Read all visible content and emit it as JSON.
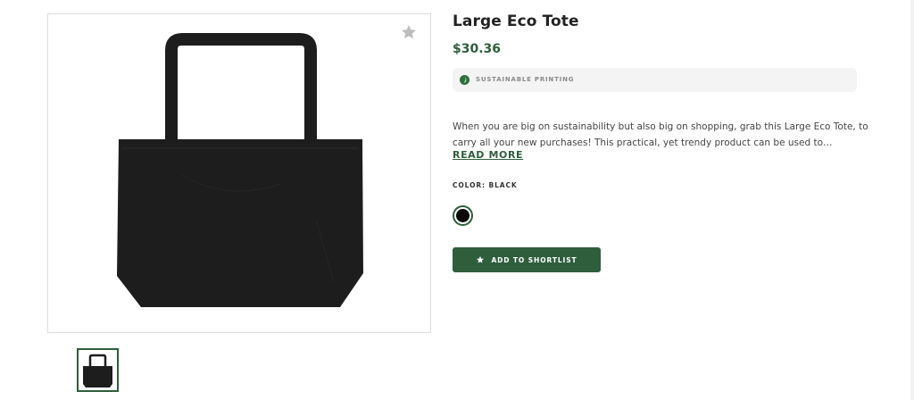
{
  "product": {
    "title": "Large Eco Tote",
    "price": "$30.36",
    "badge": "SUSTAINABLE PRINTING",
    "description": "When you are big on sustainability but also big on shopping, grab this Large Eco Tote, to carry all your new purchases! This practical, yet trendy product can be used to…",
    "read_more": "READ MORE",
    "color_label": "COLOR:",
    "color_value": "BLACK",
    "add_to_shortlist": "ADD TO SHORTLIST"
  },
  "colors": {
    "accent": "#2e5e3c",
    "bag": "#1d1d1d",
    "swatch_black": "#0b0b0b"
  },
  "icons": {
    "favorite": "star-icon",
    "badge": "leaf-icon",
    "button": "star-icon"
  }
}
